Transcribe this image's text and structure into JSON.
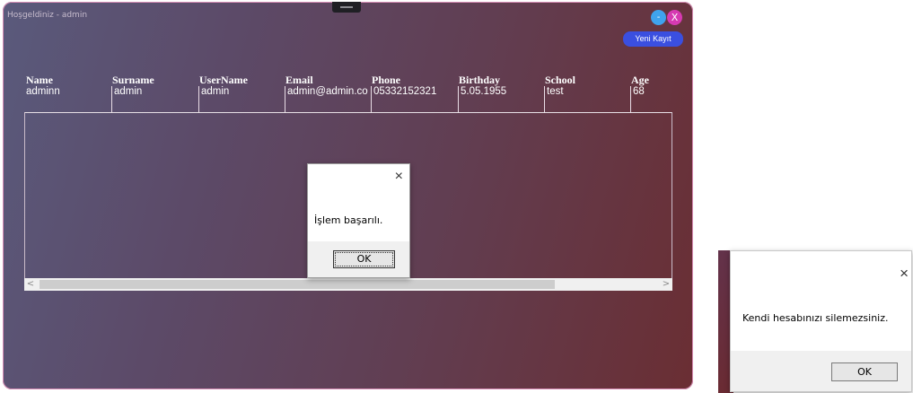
{
  "window": {
    "welcome": "Hoşgeldiniz - admin",
    "minimize_label": "-",
    "close_label": "X",
    "new_record_label": "Yeni Kayıt"
  },
  "grid": {
    "columns": [
      "Name",
      "Surname",
      "UserName",
      "Email",
      "Phone",
      "Birthday",
      "School",
      "Age"
    ],
    "rows": [
      [
        "adminn",
        "admin",
        "admin",
        "admin@admin.co",
        "05332152321",
        "5.05.1955",
        "test",
        "68"
      ]
    ],
    "scroll_left": "<",
    "scroll_right": ">"
  },
  "dialog_success": {
    "close_icon": "×",
    "message": "İşlem başarılı.",
    "ok_label": "OK"
  },
  "dialog_error": {
    "close_icon": "×",
    "message": "Kendi hesabınızı silemezsiniz.",
    "ok_label": "OK"
  }
}
